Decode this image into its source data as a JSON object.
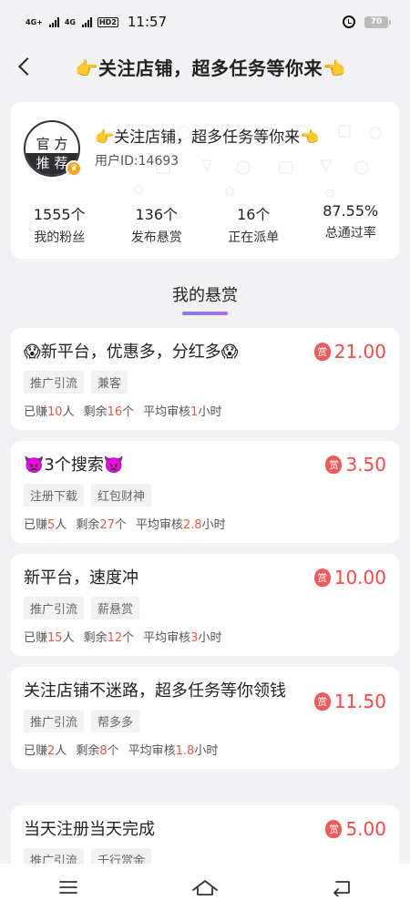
{
  "status_bar": {
    "net1": "4G+",
    "net2": "4G",
    "hd": "HD2",
    "time": "11:57",
    "battery": "70"
  },
  "header": {
    "title": "👉关注店铺，超多任务等你来👈"
  },
  "shop": {
    "avatar_top": "官 方",
    "avatar_bottom": "推 荐",
    "name": "👉关注店铺，超多任务等你来👈",
    "user_id": "用户ID:14693",
    "stats": [
      {
        "value": "1555个",
        "label": "我的粉丝"
      },
      {
        "value": "136个",
        "label": "发布悬赏"
      },
      {
        "value": "16个",
        "label": "正在派单"
      },
      {
        "value": "87.55%",
        "label": "总通过率"
      }
    ]
  },
  "section": {
    "title": "我的悬赏"
  },
  "tasks": [
    {
      "title": "😱新平台，优惠多，分红多😱",
      "reward_badge": "赏",
      "amount": "21.00",
      "tags": [
        "推广引流",
        "兼客"
      ],
      "earned_label": "已赚",
      "earned": "10",
      "earned_unit": "人",
      "remain_label": "剩余",
      "remain": "16",
      "remain_unit": "个",
      "review_label": "平均审核",
      "review": "1",
      "review_unit": "小时"
    },
    {
      "title": "👿3个搜索👿",
      "reward_badge": "赏",
      "amount": "3.50",
      "tags": [
        "注册下载",
        "红包财神"
      ],
      "earned_label": "已赚",
      "earned": "5",
      "earned_unit": "人",
      "remain_label": "剩余",
      "remain": "27",
      "remain_unit": "个",
      "review_label": "平均审核",
      "review": "2.8",
      "review_unit": "小时"
    },
    {
      "title": "新平台，速度冲",
      "reward_badge": "赏",
      "amount": "10.00",
      "tags": [
        "推广引流",
        "薪悬赏"
      ],
      "earned_label": "已赚",
      "earned": "15",
      "earned_unit": "人",
      "remain_label": "剩余",
      "remain": "12",
      "remain_unit": "个",
      "review_label": "平均审核",
      "review": "3",
      "review_unit": "小时"
    },
    {
      "title": "关注店铺不迷路，超多任务等你领钱",
      "reward_badge": "赏",
      "amount": "11.50",
      "tags": [
        "推广引流",
        "帮多多"
      ],
      "earned_label": "已赚",
      "earned": "2",
      "earned_unit": "人",
      "remain_label": "剩余",
      "remain": "8",
      "remain_unit": "个",
      "review_label": "平均审核",
      "review": "1.8",
      "review_unit": "小时"
    },
    {
      "title": "当天注册当天完成",
      "reward_badge": "赏",
      "amount": "5.00",
      "tags": [
        "推广引流",
        "千行赏金"
      ]
    }
  ],
  "colors": {
    "accent_red": "#ef4a4a",
    "underline_start": "#7f7ff5",
    "underline_end": "#b36af5"
  },
  "icons": {
    "nav_back": "chevron-left-icon",
    "bottom_menu": "menu-icon",
    "bottom_home": "home-icon",
    "bottom_back": "return-icon"
  }
}
